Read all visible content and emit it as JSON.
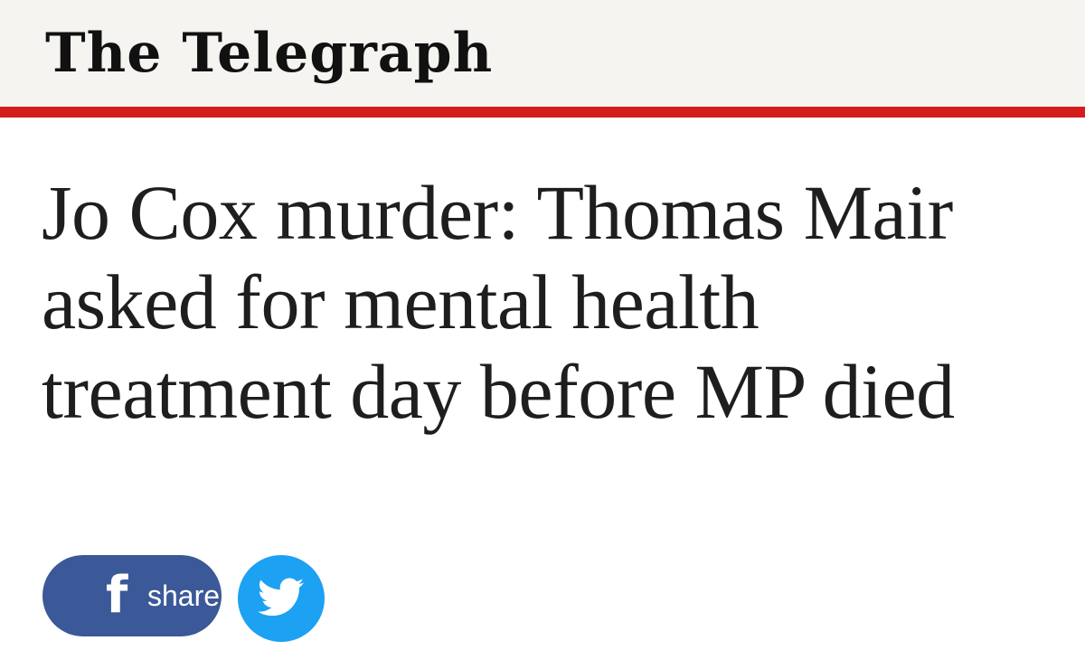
{
  "masthead": {
    "title": "The Telegraph"
  },
  "article": {
    "headline": "Jo Cox murder: Thomas Mair asked for mental health treatment day before MP died"
  },
  "share": {
    "facebook_icon": "f",
    "facebook_label": "share",
    "twitter_icon": "twitter-bird-icon"
  },
  "colors": {
    "masthead_bg": "#f6f4f1",
    "accent_red": "#d41c1c",
    "facebook_blue": "#3b5998",
    "twitter_blue": "#1da1f2",
    "headline_text": "#1e1e1e"
  }
}
